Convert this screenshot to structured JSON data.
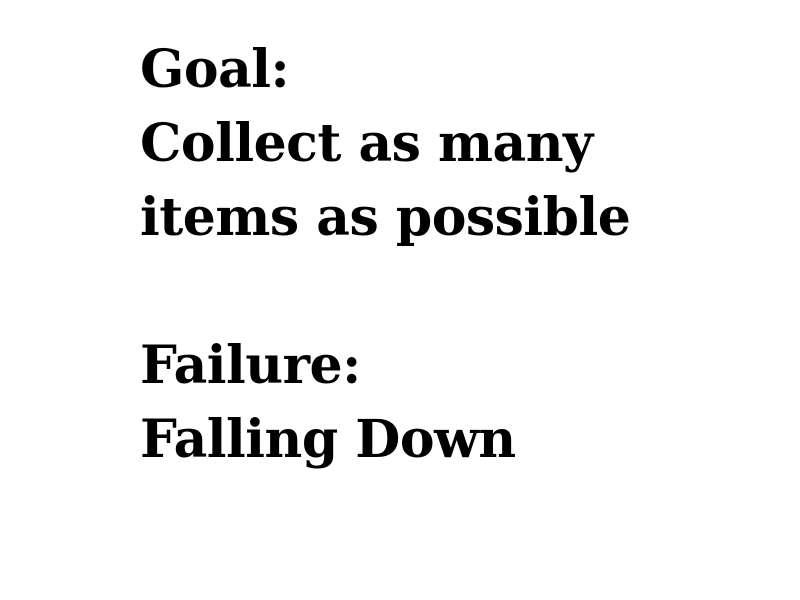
{
  "goal": {
    "heading": "Goal:",
    "lines": [
      "Collect as many",
      "items as possible"
    ]
  },
  "failure": {
    "heading": "Failure:",
    "line": "Falling Down"
  },
  "colors": {
    "background": "#ffffff",
    "text": "#000000"
  }
}
